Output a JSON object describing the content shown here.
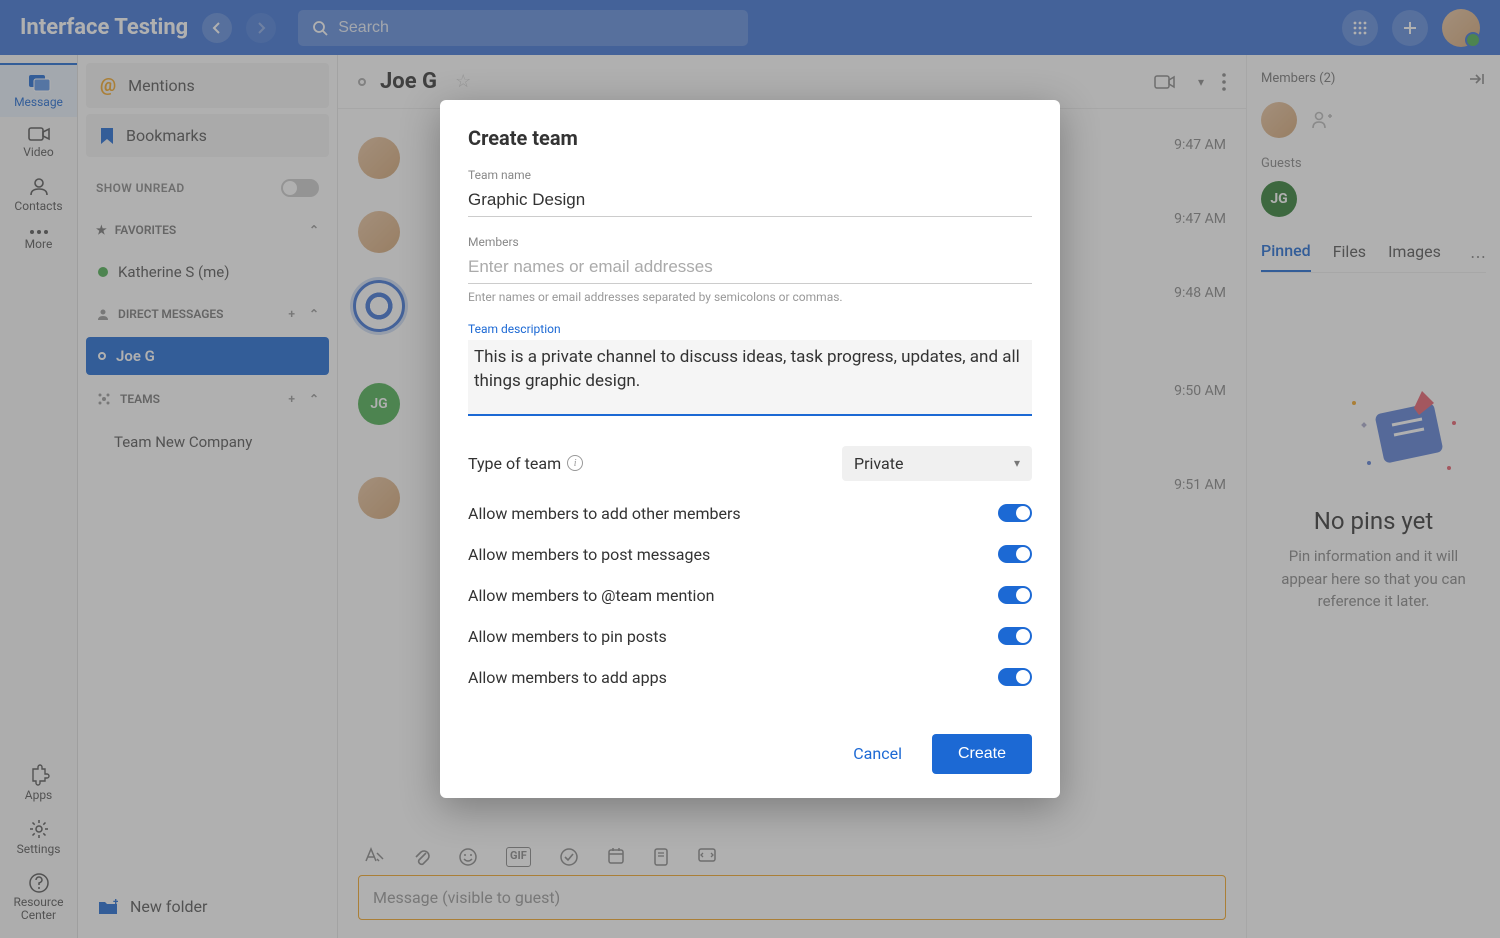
{
  "header": {
    "title": "Interface Testing",
    "search_placeholder": "Search"
  },
  "rail": {
    "message": "Message",
    "video": "Video",
    "contacts": "Contacts",
    "more": "More",
    "apps": "Apps",
    "settings": "Settings",
    "resource_center": "Resource Center"
  },
  "sidebar": {
    "mentions": "Mentions",
    "bookmarks": "Bookmarks",
    "show_unread": "SHOW UNREAD",
    "favorites": "FAVORITES",
    "me_item": "Katherine S (me)",
    "direct_messages": "DIRECT MESSAGES",
    "dm_active": "Joe G",
    "teams": "TEAMS",
    "team_item": "Team New Company",
    "new_folder": "New folder"
  },
  "conversation": {
    "title": "Joe G",
    "times": [
      "9:47 AM",
      "9:47 AM",
      "9:48 AM",
      "9:50 AM",
      "9:51 AM"
    ],
    "compose_placeholder": "Message (visible to guest)"
  },
  "right_panel": {
    "members_label": "Members (2)",
    "guests_label": "Guests",
    "jg_initials": "JG",
    "tabs": {
      "pinned": "Pinned",
      "files": "Files",
      "images": "Images"
    },
    "empty_title": "No pins yet",
    "empty_body": "Pin information and it will appear here so that you can reference it later."
  },
  "modal": {
    "title": "Create team",
    "team_name_label": "Team name",
    "team_name_value": "Graphic Design",
    "members_label": "Members",
    "members_placeholder": "Enter names or email addresses",
    "members_hint": "Enter names or email addresses separated by semicolons or commas.",
    "desc_label": "Team description",
    "desc_value": "This is a private channel to discuss ideas, task progress, updates, and all things graphic design.",
    "type_label": "Type of team",
    "type_value": "Private",
    "switches": {
      "add_members": "Allow members to add other members",
      "post_messages": "Allow members to post messages",
      "team_mention": "Allow members to @team mention",
      "pin_posts": "Allow members to pin posts",
      "add_apps": "Allow members to add apps"
    },
    "cancel": "Cancel",
    "create": "Create"
  }
}
